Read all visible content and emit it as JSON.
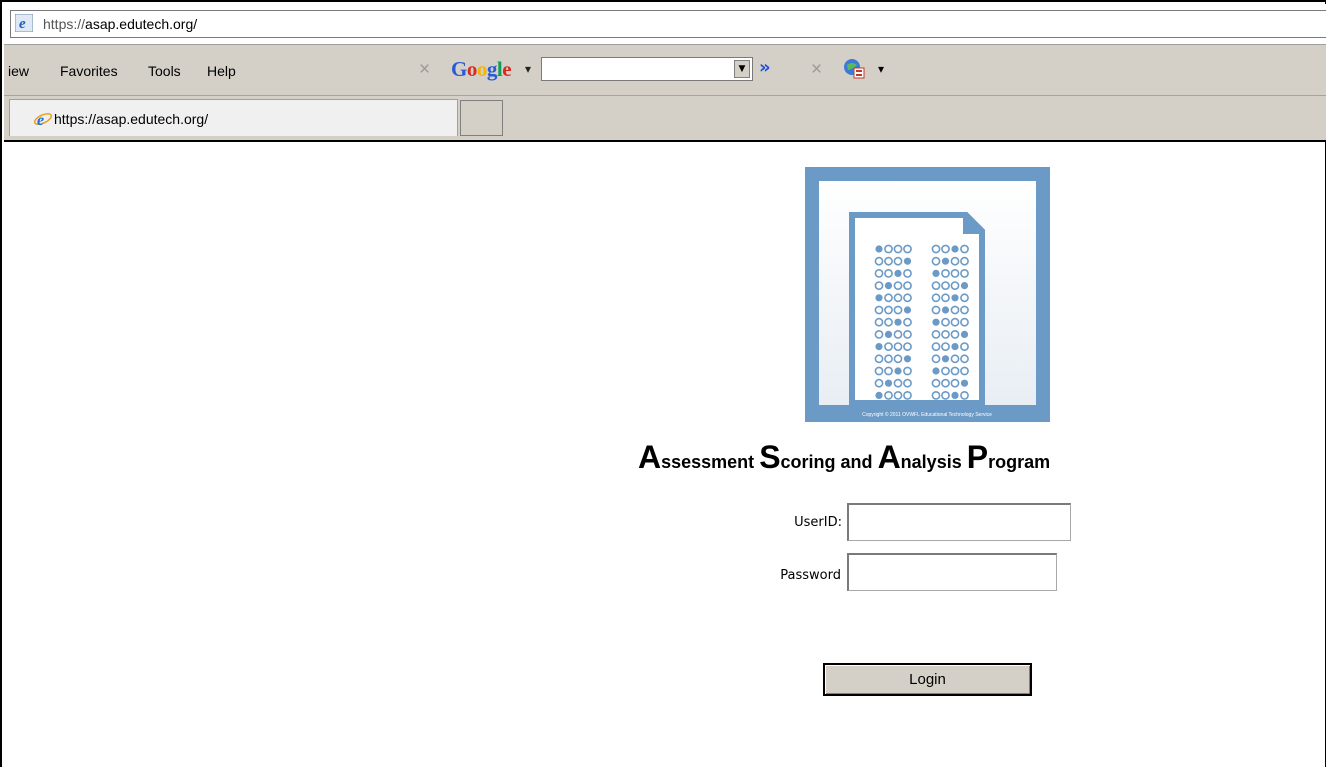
{
  "browser": {
    "address": {
      "protocol": "https://",
      "host": "asap.edutech.org/"
    },
    "menu": {
      "items": [
        "View",
        "Favorites",
        "Tools",
        "Help"
      ],
      "visible_items": [
        "iew",
        "Favorites",
        "Tools",
        "Help"
      ]
    },
    "toolbar": {
      "google_label": "Google",
      "search_value": "",
      "more_label": "»"
    },
    "tab": {
      "title": "https://asap.edutech.org/"
    }
  },
  "page": {
    "logo": {
      "icon": "answer-sheet-logo",
      "copyright": "Copyright © 2011 OVWFL Educational Technology Service"
    },
    "title_words": [
      {
        "initial": "A",
        "rest": "ssessment"
      },
      {
        "initial": "S",
        "rest": "coring and"
      },
      {
        "initial": "A",
        "rest": "nalysis"
      },
      {
        "initial": "P",
        "rest": "rogram"
      }
    ],
    "form": {
      "userid_label": "UserID:",
      "userid_value": "",
      "password_label": "Password",
      "password_value": "",
      "login_label": "Login"
    }
  },
  "colors": {
    "chrome": "#d4d0c8",
    "logo_blue": "#6b9ac6",
    "google_blue": "#2a5bd7"
  }
}
